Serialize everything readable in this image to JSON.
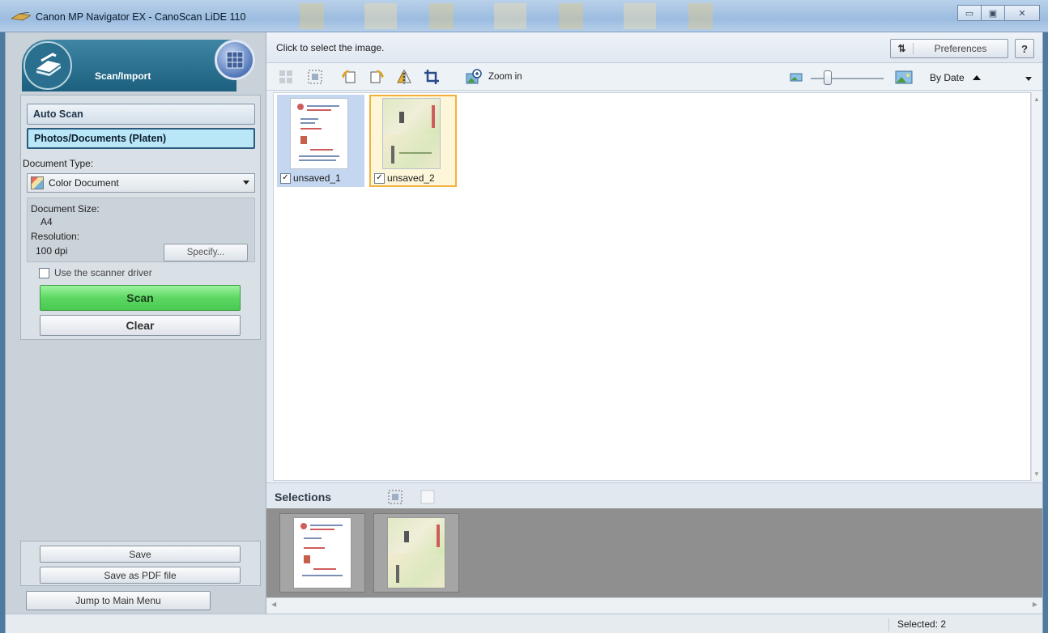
{
  "window": {
    "title": "Canon MP Navigator EX - CanoScan LiDE 110",
    "controls": [
      "minimize",
      "maximize",
      "close"
    ]
  },
  "left_panel": {
    "header_label": "Scan/Import",
    "modes": [
      {
        "label": "Auto Scan",
        "selected": false
      },
      {
        "label": "Photos/Documents (Platen)",
        "selected": true
      }
    ],
    "document_type_label": "Document Type:",
    "document_type_value": "Color Document",
    "document_size_label": "Document Size:",
    "document_size_value": "A4",
    "resolution_label": "Resolution:",
    "resolution_value": "100 dpi",
    "specify_label": "Specify...",
    "use_driver_label": "Use the scanner driver",
    "use_driver_checked": false,
    "scan_label": "Scan",
    "clear_label": "Clear",
    "save_label": "Save",
    "save_pdf_label": "Save as PDF file",
    "main_menu_label": "Jump to Main Menu"
  },
  "main": {
    "hint": "Click to select the image.",
    "preferences_label": "Preferences",
    "help_label": "?",
    "zoom_label": "Zoom in",
    "sort_label": "By Date",
    "thumbnails": [
      {
        "name": "unsaved_1",
        "checked": true,
        "state": "selected"
      },
      {
        "name": "unsaved_2",
        "checked": true,
        "state": "focused"
      }
    ],
    "selections_label": "Selections",
    "status": "Selected: 2"
  },
  "colors": {
    "scan_green": "#5cd862",
    "header_teal": "#1c5f7e",
    "focus_orange": "#f2b13a",
    "selection_blue": "#c4d6f0"
  }
}
